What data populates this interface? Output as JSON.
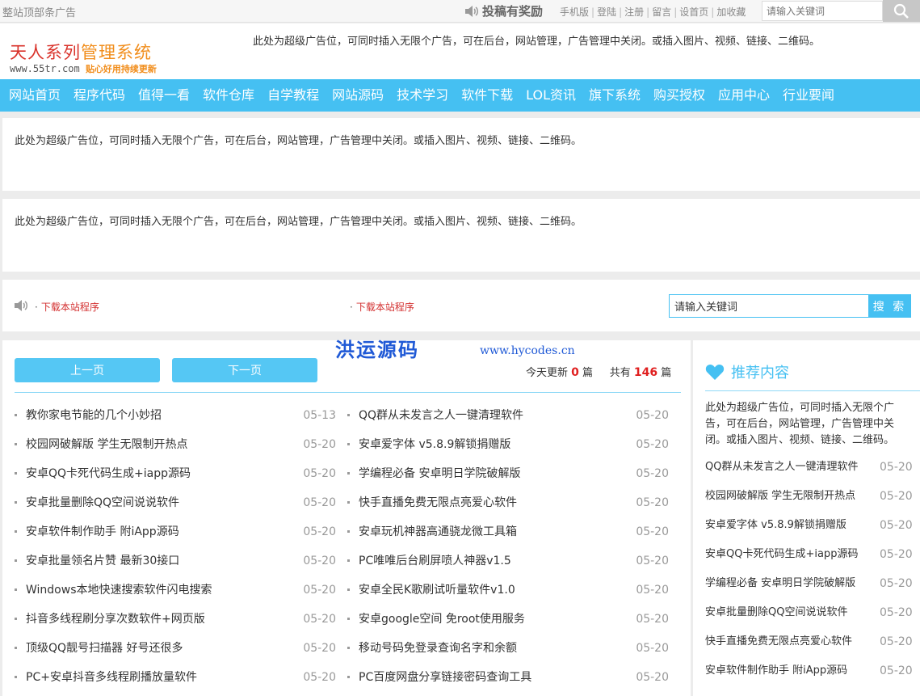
{
  "topbar": {
    "ad_text": "整站顶部条广告",
    "tougao": "投稿有奖励",
    "links": [
      "手机版",
      "登陆",
      "注册",
      "留言",
      "设首页",
      "加收藏"
    ],
    "search_placeholder": "请输入关键词"
  },
  "header": {
    "logo_title_a": "天人系列",
    "logo_title_b": "管理系统",
    "logo_url": "www.55tr.com",
    "logo_tag": "贴心好用持续更新",
    "ad_text": "此处为超级广告位，可同时插入无限个广告，可在后台，网站管理，广告管理中关闭。或插入图片、视频、链接、二维码。"
  },
  "nav": [
    "网站首页",
    "程序代码",
    "值得一看",
    "软件仓库",
    "自学教程",
    "网站源码",
    "技术学习",
    "软件下载",
    "LOL资讯",
    "旗下系统",
    "购买授权",
    "应用中心",
    "行业要闻"
  ],
  "ads": {
    "block1": "此处为超级广告位，可同时插入无限个广告，可在后台，网站管理，广告管理中关闭。或插入图片、视频、链接、二维码。",
    "block2": "此处为超级广告位，可同时插入无限个广告，可在后台，网站管理，广告管理中关闭。或插入图片、视频、链接、二维码。"
  },
  "notice": {
    "item1": "下载本站程序",
    "item2": "下载本站程序",
    "search_value": "请输入关键词",
    "search_btn": "搜 索"
  },
  "watermark": {
    "name": "洪运源码",
    "url": "www.hycodes.cn"
  },
  "main": {
    "prev": "上一页",
    "next": "下一页",
    "today_label": "今天更新",
    "today_count": "0",
    "unit1": "篇",
    "total_label": "共有",
    "total_count": "146",
    "unit2": "篇",
    "left_list": [
      {
        "title": "教你家电节能的几个小妙招",
        "date": "05-13"
      },
      {
        "title": "校园网破解版 学生无限制开热点",
        "date": "05-20"
      },
      {
        "title": "安卓QQ卡死代码生成+iapp源码",
        "date": "05-20"
      },
      {
        "title": "安卓批量删除QQ空间说说软件",
        "date": "05-20"
      },
      {
        "title": "安卓软件制作助手 附iApp源码",
        "date": "05-20"
      },
      {
        "title": "安卓批量领名片赞 最新30接口",
        "date": "05-20"
      },
      {
        "title": "Windows本地快速搜索软件闪电搜索",
        "date": "05-20"
      },
      {
        "title": "抖音多线程刷分享次数软件+网页版",
        "date": "05-20"
      },
      {
        "title": "顶级QQ靓号扫描器 好号还很多",
        "date": "05-20"
      },
      {
        "title": "PC+安卓抖音多线程刷播放量软件",
        "date": "05-20"
      }
    ],
    "right_list": [
      {
        "title": "QQ群从未发言之人一键清理软件",
        "date": "05-20"
      },
      {
        "title": "安卓爱字体 v5.8.9解锁捐赠版",
        "date": "05-20"
      },
      {
        "title": "学编程必备 安卓明日学院破解版",
        "date": "05-20"
      },
      {
        "title": "快手直播免费无限点亮爱心软件",
        "date": "05-20"
      },
      {
        "title": "安卓玩机神器高通骁龙微工具箱",
        "date": "05-20"
      },
      {
        "title": "PC唯唯后台刷屏喷人神器v1.5",
        "date": "05-20"
      },
      {
        "title": "安卓全民K歌刷试听量软件v1.0",
        "date": "05-20"
      },
      {
        "title": "安卓google空间 免root使用服务",
        "date": "05-20"
      },
      {
        "title": "移动号码免登录查询名字和余额",
        "date": "05-20"
      },
      {
        "title": "PC百度网盘分享链接密码查询工具",
        "date": "05-20"
      }
    ]
  },
  "sidebar": {
    "title": "推荐内容",
    "ad_text": "此处为超级广告位，可同时插入无限个广告，可在后台，网站管理，广告管理中关闭。或插入图片、视频、链接、二维码。",
    "list": [
      {
        "title": "QQ群从未发言之人一键清理软件",
        "date": "05-20"
      },
      {
        "title": "校园网破解版 学生无限制开热点",
        "date": "05-20"
      },
      {
        "title": "安卓爱字体 v5.8.9解锁捐赠版",
        "date": "05-20"
      },
      {
        "title": "安卓QQ卡死代码生成+iapp源码",
        "date": "05-20"
      },
      {
        "title": "学编程必备 安卓明日学院破解版",
        "date": "05-20"
      },
      {
        "title": "安卓批量删除QQ空间说说软件",
        "date": "05-20"
      },
      {
        "title": "快手直播免费无限点亮爱心软件",
        "date": "05-20"
      },
      {
        "title": "安卓软件制作助手 附iApp源码",
        "date": "05-20"
      }
    ]
  },
  "colors": {
    "accent": "#45c0f2",
    "logo_red": "#d9322a",
    "logo_orange": "#f18d1b",
    "count_red": "#e02020"
  },
  "icons": [
    "speaker-icon",
    "search-icon",
    "heart-icon"
  ]
}
